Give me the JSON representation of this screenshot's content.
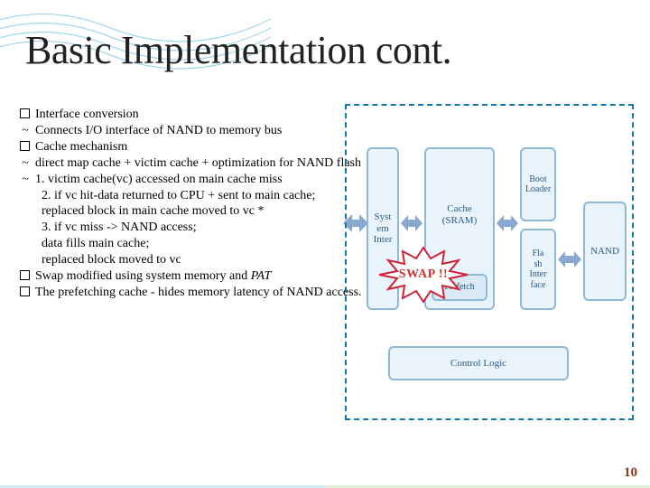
{
  "title": "Basic Implementation cont.",
  "bullets": {
    "b1": "Interface conversion",
    "b1s": "Connects I/O interface of NAND to memory bus",
    "b2": "Cache mechanism",
    "b2s1": "direct map cache + victim cache + optimization for NAND flash",
    "b2s2a": "1. victim cache(vc) accessed on main cache miss",
    "b2s2b": "2. if vc hit-data returned to CPU + sent to main cache;",
    "b2s2c": "replaced block in main cache moved to vc *",
    "b2s2d": "3. if vc miss -> NAND access;",
    "b2s2e": "data fills main cache;",
    "b2s2f": "replaced block moved to vc",
    "b3a": "Swap modified using system memory and ",
    "b3b": "PAT",
    "b4": "The prefetching cache - hides memory latency of NAND access."
  },
  "diagram": {
    "sys": "Syst\nem\nInter",
    "cache": "Cache\n(SRAM)",
    "boot": "Boot\nLoader",
    "prefetch": "Prefetch",
    "flashif": "Fla\nsh\nInter\nface",
    "nand": "NAND",
    "ctrl": "Control Logic"
  },
  "burst": "SWAP !!",
  "page": "10"
}
